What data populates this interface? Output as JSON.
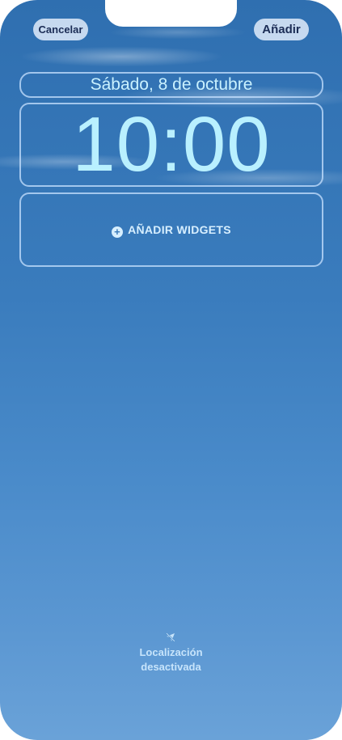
{
  "header": {
    "cancel_label": "Cancelar",
    "add_label": "Añadir"
  },
  "lock_screen": {
    "date": "Sábado, 8 de octubre",
    "time": "10:00",
    "add_widgets_label": "AÑADIR WIDGETS",
    "location_line1": "Localización",
    "location_line2": "desactivada"
  },
  "colors": {
    "sky_top": "#2f6fb0",
    "sky_bottom": "#6aa2d8",
    "clock_color": "#b9f0ff",
    "button_bg": "#e1ebfa",
    "button_text": "#1b2c55"
  },
  "icons": {
    "add_widget": "plus-circle-icon",
    "location": "location-slash-icon"
  }
}
